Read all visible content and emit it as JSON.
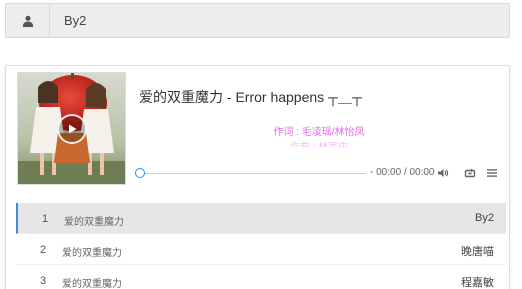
{
  "artist": {
    "name": "By2",
    "icon": "user-icon"
  },
  "player": {
    "title": "爱的双重魔力 - Error happens ┬＿┬",
    "lyric_current": "作词 : 毛凌瑶/林怡凤",
    "lyric_next": "作曲 : 林宇中",
    "time": "- 00:00 / 00:00",
    "progress": 0,
    "colors": {
      "lyric_active": "#e46ce8",
      "accent": "#3e8ede"
    },
    "icons": [
      "play-icon",
      "volume-icon",
      "loop-icon",
      "menu-icon"
    ]
  },
  "playlist": [
    {
      "num": "1",
      "name": "爱的双重魔力",
      "singer": "By2",
      "current": true
    },
    {
      "num": "2",
      "name": "爱的双重魔力",
      "singer": "晚唐喵",
      "current": false
    },
    {
      "num": "3",
      "name": "爱的双重魔力",
      "singer": "程嘉敏",
      "current": false
    }
  ]
}
